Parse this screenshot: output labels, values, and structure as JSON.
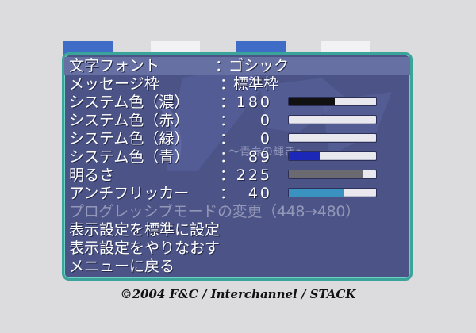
{
  "background": {
    "subtitle": "〜青春の輝き〜"
  },
  "menu": {
    "items": [
      {
        "label": "文字フォント",
        "value": "ゴシック",
        "selected": true
      },
      {
        "label": "メッセージ枠",
        "value": "標準枠"
      },
      {
        "label": "システム色（濃）",
        "value": "180",
        "level": 0.53,
        "bar_color": "#111111"
      },
      {
        "label": "システム色（赤）",
        "value": "0",
        "level": 0.0,
        "bar_color": "#cc2222"
      },
      {
        "label": "システム色（緑）",
        "value": "0",
        "level": 0.0,
        "bar_color": "#22aa22"
      },
      {
        "label": "システム色（青）",
        "value": "89",
        "level": 0.35,
        "bar_color": "#1c28b8"
      },
      {
        "label": "明るさ",
        "value": "225",
        "level": 0.85,
        "bar_color": "#6a6a70"
      },
      {
        "label": "アンチフリッカー",
        "value": "40",
        "level": 0.64,
        "bar_color": "#3a92c0"
      },
      {
        "label": "プログレッシブモードの変更（448→480）",
        "disabled": true
      },
      {
        "label": "表示設定を標準に設定"
      },
      {
        "label": "表示設定をやりなおす"
      },
      {
        "label": "メニューに戻る"
      }
    ],
    "colon": "："
  },
  "footer": {
    "copyright": "©2004  F&C / Interchannel / STACK"
  },
  "colors": {
    "window_bg": "#4c5487",
    "window_border": "#3aa39a",
    "selection": "#6770a2"
  }
}
